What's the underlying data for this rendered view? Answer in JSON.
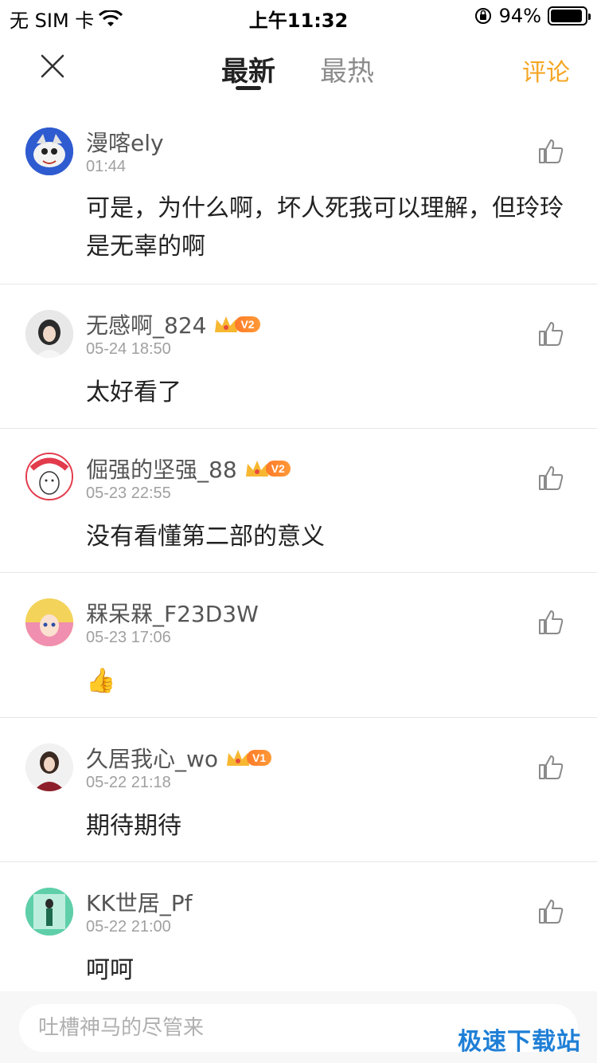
{
  "status_bar": {
    "carrier": "无 SIM 卡",
    "time": "上午11:32",
    "battery": "94%",
    "battery_level": 0.94
  },
  "nav": {
    "tabs": [
      {
        "label": "最新",
        "active": true
      },
      {
        "label": "最热",
        "active": false
      }
    ],
    "comment_label": "评论",
    "accent_color": "#f5a623"
  },
  "comments": [
    {
      "user": "漫喀ely",
      "time": "01:44",
      "text": "可是，为什么啊，坏人死我可以理解，但玲玲是无辜的啊",
      "vip": ""
    },
    {
      "user": "无感啊_824",
      "time": "05-24 18:50",
      "text": "太好看了",
      "vip": "V2"
    },
    {
      "user": "倔强的坚强_88",
      "time": "05-23 22:55",
      "text": "没有看懂第二部的意义",
      "vip": "V2"
    },
    {
      "user": "槑呆槑_F23D3W",
      "time": "05-23 17:06",
      "text": "👍",
      "vip": ""
    },
    {
      "user": "久居我心_wo",
      "time": "05-22 21:18",
      "text": "期待期待",
      "vip": "V1"
    },
    {
      "user": "KK世居_Pf",
      "time": "05-22 21:00",
      "text": "呵呵",
      "vip": ""
    }
  ],
  "input": {
    "placeholder": "吐槽神马的尽管来"
  },
  "watermark": "极速下载站"
}
